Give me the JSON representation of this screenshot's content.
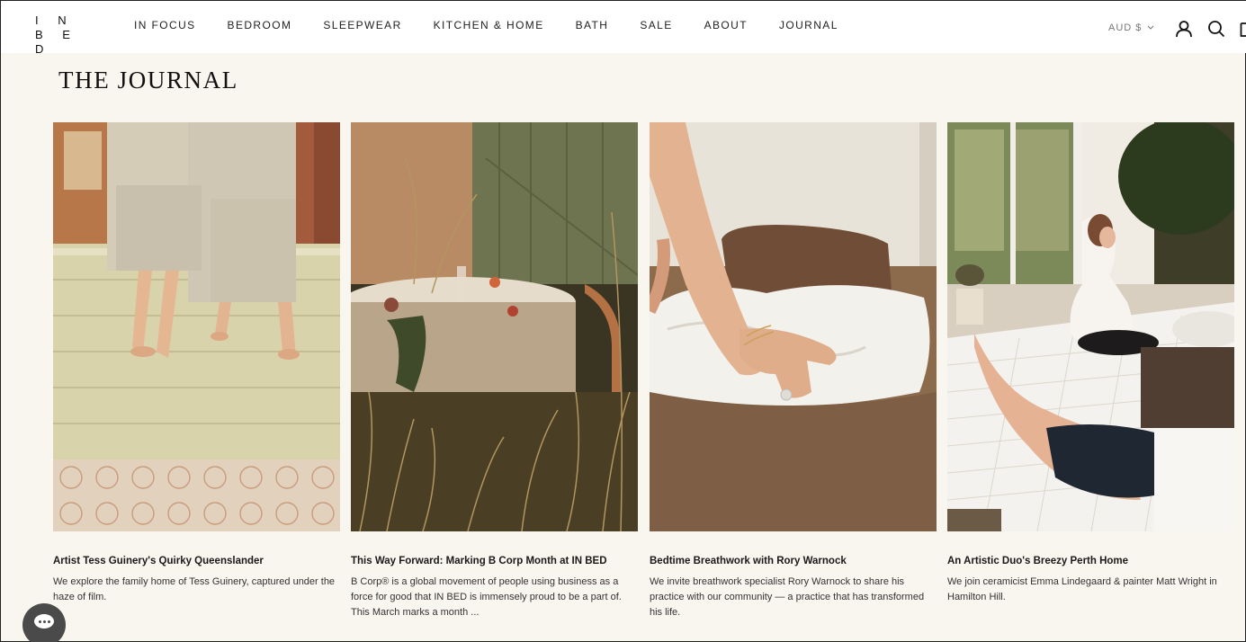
{
  "brand": {
    "logo_line1": "I N",
    "logo_line2": "B E D"
  },
  "nav": {
    "items": [
      {
        "label": "IN FOCUS"
      },
      {
        "label": "BEDROOM"
      },
      {
        "label": "SLEEPWEAR"
      },
      {
        "label": "KITCHEN & HOME"
      },
      {
        "label": "BATH"
      },
      {
        "label": "SALE"
      },
      {
        "label": "ABOUT"
      },
      {
        "label": "JOURNAL"
      }
    ]
  },
  "header": {
    "currency": "AUD $",
    "icons": [
      "account-icon",
      "search-icon",
      "cart-icon"
    ]
  },
  "page": {
    "title": "THE JOURNAL"
  },
  "articles": [
    {
      "title": "Artist Tess Guinery's Quirky Queenslander",
      "description": "We explore the family home of Tess Guinery, captured under the haze of film."
    },
    {
      "title": "This Way Forward: Marking B Corp Month at IN BED",
      "description": "B Corp® is a global movement of people using business as a force for good that IN BED is immensely proud to be a part of. This March marks a month ..."
    },
    {
      "title": "Bedtime Breathwork with Rory Warnock",
      "description": "We invite breathwork specialist Rory Warnock to share his practice with our community — a practice that has transformed his life."
    },
    {
      "title": "An Artistic Duo's Breezy Perth Home",
      "description": "We join ceramicist Emma Lindegaard & painter Matt Wright in Hamilton Hill."
    }
  ],
  "colors": {
    "background": "#f9f5ef",
    "header": "#ffffff",
    "text": "#1a1a1a",
    "chat": "#4a4a4a"
  }
}
